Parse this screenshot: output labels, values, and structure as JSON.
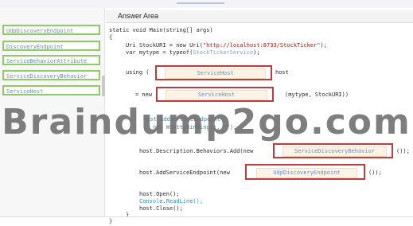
{
  "answer_area_title": "Answer Area",
  "options": [
    "UdpDiscoveryEndpoint",
    "DiscoveryEndpoint",
    "ServiceBehaviorAttribute",
    "ServiceDiscoveryBehavior",
    "ServiceHost"
  ],
  "code": {
    "line_main": "static void Main(string[] args)",
    "line_open_brace": "{",
    "line_uri_prefix": "Uri StockURI = new Uri(",
    "line_uri_string": "\"http://localhost:8733/StockTicker\"",
    "line_uri_suffix": ");",
    "line_var_prefix": "var mytype = typeof(",
    "line_var_type": "StockTickerService",
    "line_var_suffix": ");",
    "using_prefix": "using (",
    "using_suffix": "host",
    "new_prefix": "= new",
    "new_suffix": "(mytype, StockURI))",
    "obscured_line_1": "host.AddServiceEndpoint(",
    "obscured_line_2": "new WSHttpBinding(), \"\");",
    "behaviors_prefix": "host.Description.Behaviors.Add(new",
    "behaviors_suffix": "());",
    "endpoint_prefix": "host.AddServiceEndpoint(new",
    "endpoint_suffix": "());",
    "open_line": "host.Open();",
    "console_line": "Console.ReadLine();",
    "close_line": "host.Close();",
    "inner_close_brace": "}",
    "outer_close_brace": "}"
  },
  "drop_targets": {
    "using_type": "ServiceHost",
    "new_type": "ServiceHost",
    "behavior_type": "ServiceDiscoveryBehavior",
    "endpoint_type": "UdpDiscoveryEndpoint"
  },
  "watermark": "Braindump2go.com"
}
